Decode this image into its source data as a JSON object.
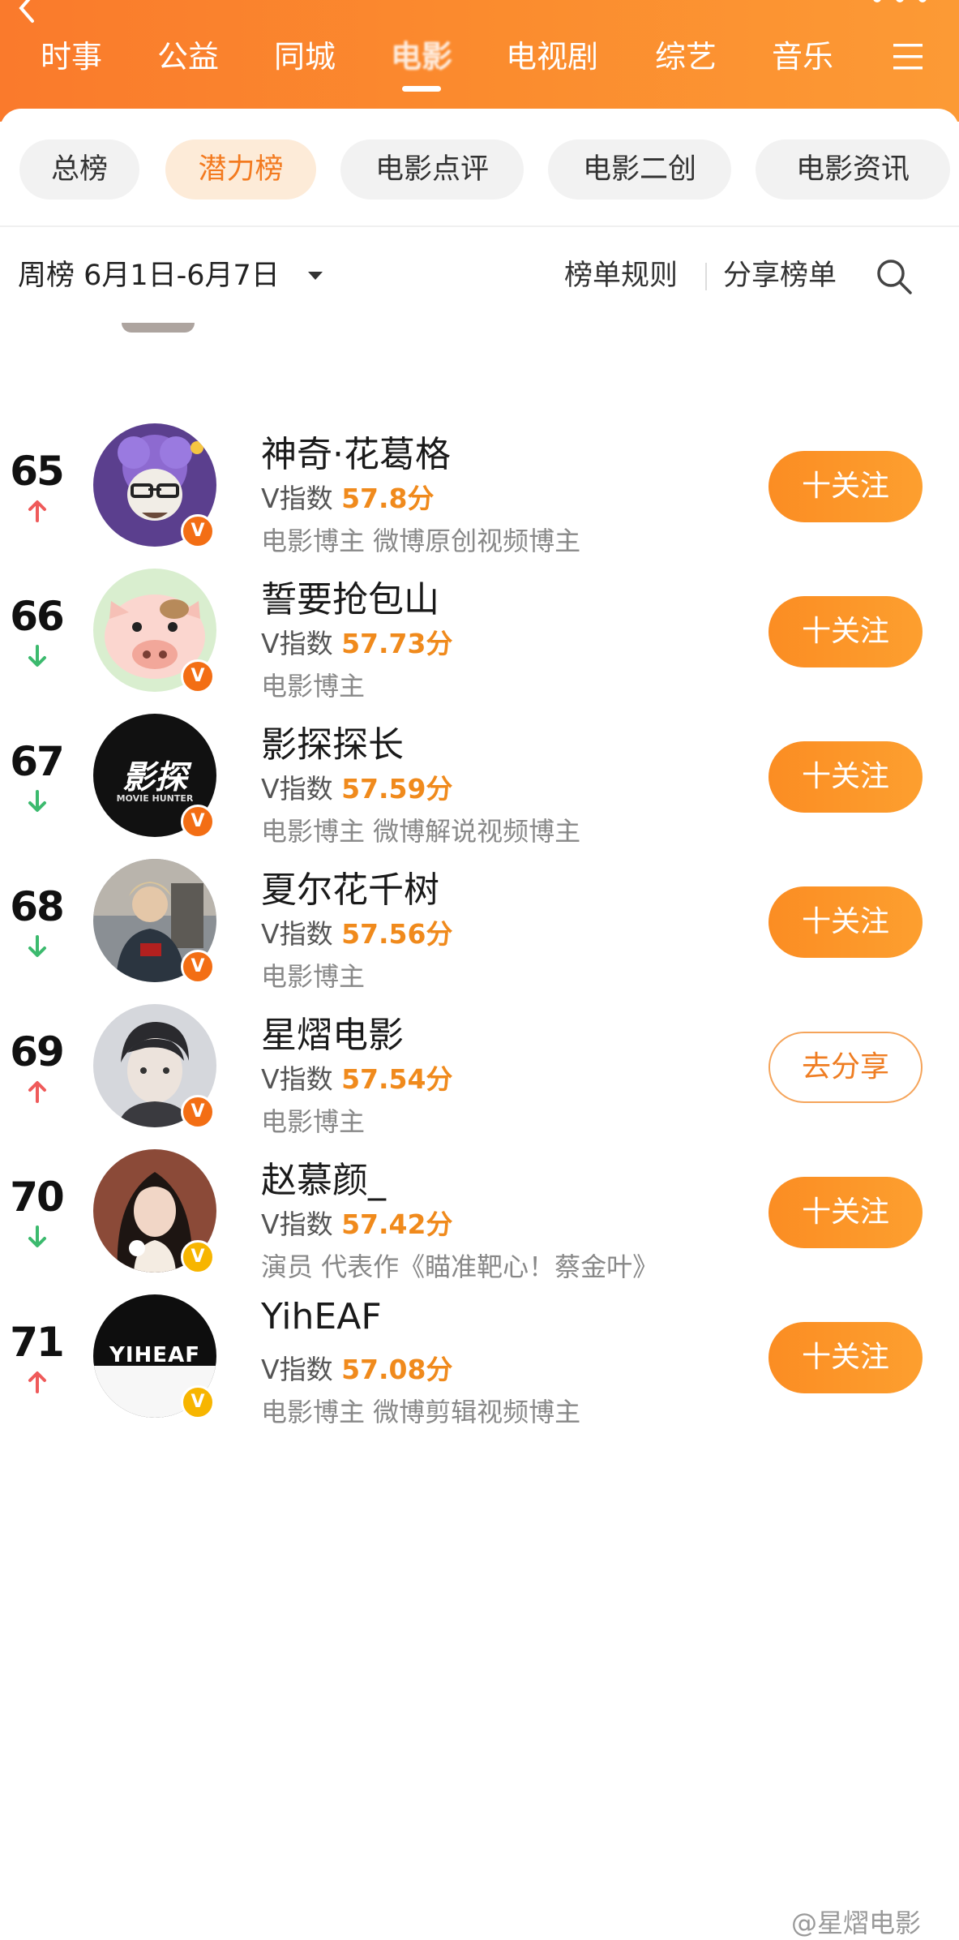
{
  "header": {
    "channels": [
      "时事",
      "公益",
      "同城",
      "电影",
      "电视剧",
      "综艺",
      "音乐"
    ],
    "active_channel": "电影"
  },
  "sub_tabs": [
    "总榜",
    "潜力榜",
    "电影点评",
    "电影二创",
    "电影资讯"
  ],
  "active_sub_tab": "潜力榜",
  "toolbar": {
    "week_label": "周榜 6月1日-6月7日",
    "rules": "榜单规则",
    "share": "分享榜单"
  },
  "rankings": [
    {
      "rank": "65",
      "trend": "up",
      "name": "神奇·花葛格",
      "score_label": "V指数",
      "score": "57.8分",
      "desc": "电影博主 微博原创视频博主",
      "action": "十关注",
      "badge": "orange"
    },
    {
      "rank": "66",
      "trend": "down",
      "name": "誓要抢包山",
      "score_label": "V指数",
      "score": "57.73分",
      "desc": "电影博主",
      "action": "十关注",
      "badge": "orange"
    },
    {
      "rank": "67",
      "trend": "down",
      "name": "影探探长",
      "score_label": "V指数",
      "score": "57.59分",
      "desc": "电影博主 微博解说视频博主",
      "action": "十关注",
      "badge": "orange",
      "avatar_text": "影探",
      "avatar_subtext": "MOVIE HUNTER"
    },
    {
      "rank": "68",
      "trend": "down",
      "name": "夏尔花千树",
      "score_label": "V指数",
      "score": "57.56分",
      "desc": "电影博主",
      "action": "十关注",
      "badge": "orange"
    },
    {
      "rank": "69",
      "trend": "up",
      "name": "星熠电影",
      "score_label": "V指数",
      "score": "57.54分",
      "desc": "电影博主",
      "action": "去分享",
      "badge": "orange"
    },
    {
      "rank": "70",
      "trend": "down",
      "name": "赵慕颜_",
      "score_label": "V指数",
      "score": "57.42分",
      "desc": "演员 代表作《瞄准靶心！蔡金叶》",
      "action": "十关注",
      "badge": "gold"
    },
    {
      "rank": "71",
      "trend": "up",
      "name": "YihEAF",
      "score_label": "V指数",
      "score": "57.08分",
      "desc": "电影博主 微博剪辑视频博主",
      "action": "十关注",
      "badge": "gold",
      "avatar_text": "YIHEAF"
    }
  ],
  "badge_letter": "V",
  "colors": {
    "accent": "#fb8d23",
    "score": "#f08a1c",
    "trend_up": "#ef5a5a",
    "trend_down": "#3cba6e"
  },
  "watermark": "@星熠电影"
}
